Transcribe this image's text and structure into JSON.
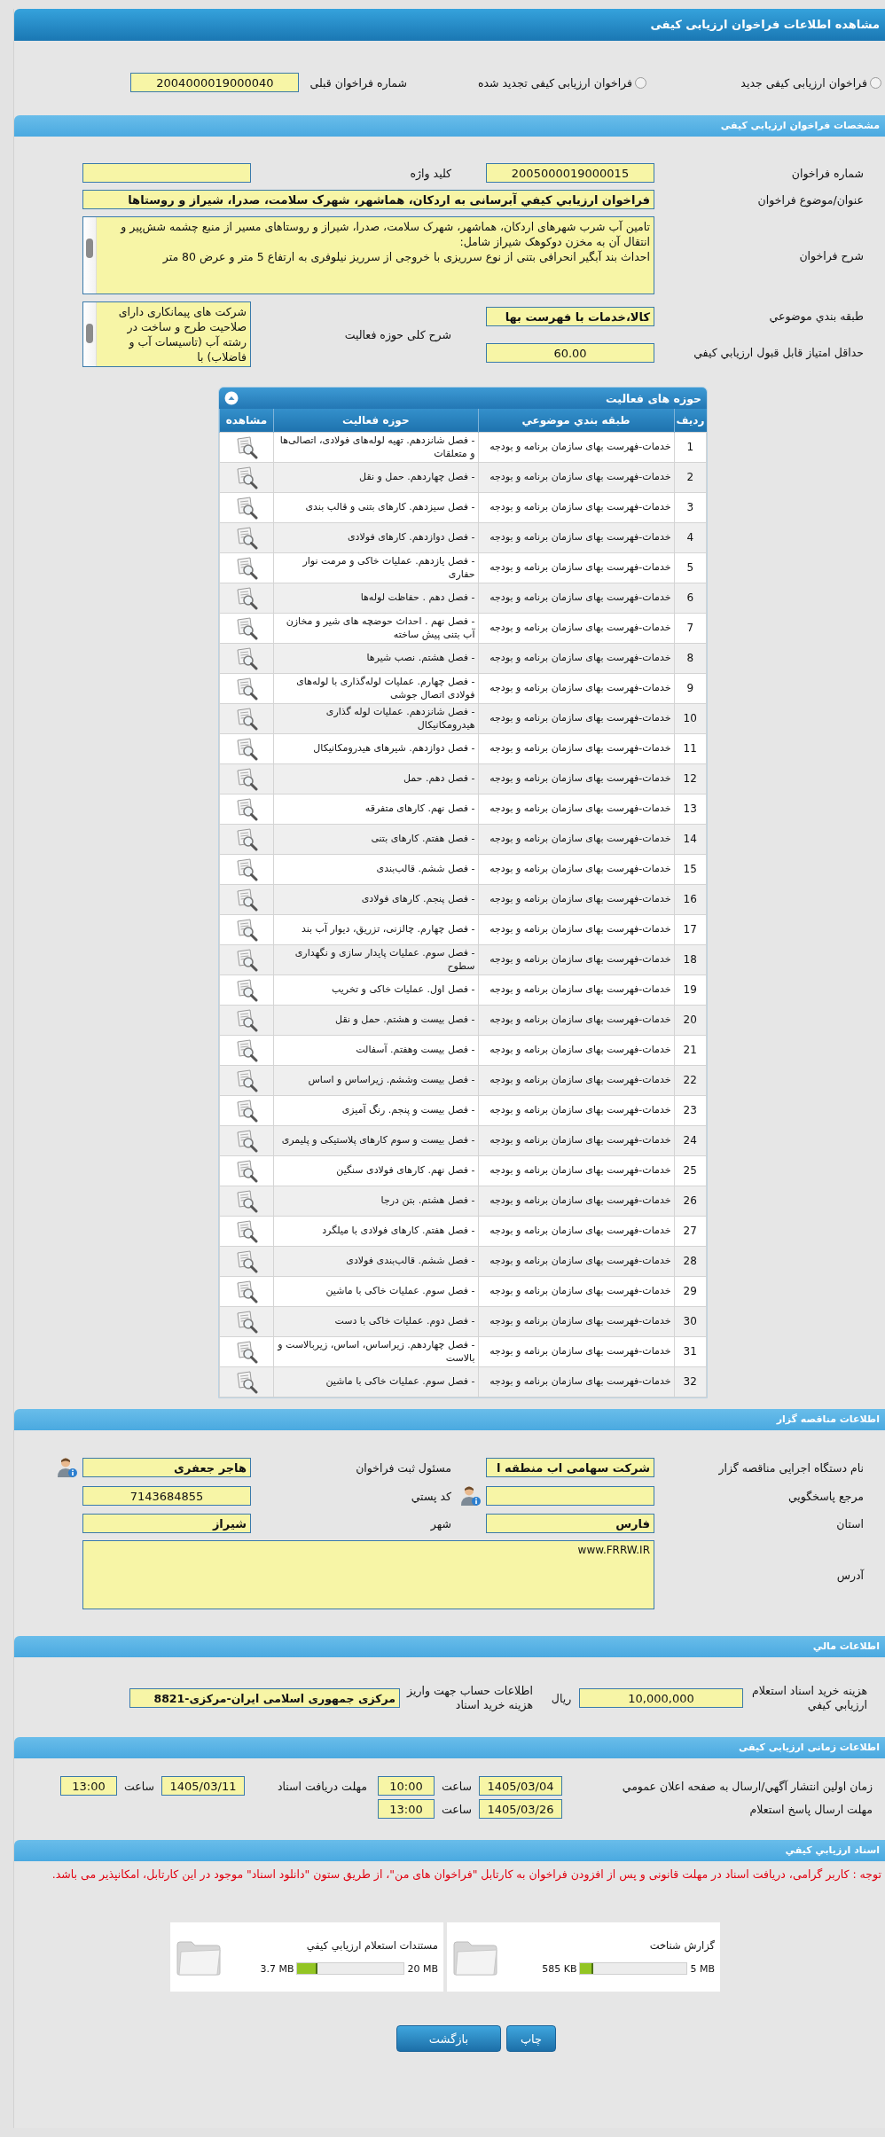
{
  "page_title": "مشاهده اطلاعات فراخوان ارزیابی کیفی",
  "call_types": [
    {
      "label": "فراخوان ارزیابی کیفی جدید",
      "selected": false
    },
    {
      "label": "فراخوان ارزیابی کیفی تجدید شده",
      "selected": false
    }
  ],
  "previous_call": {
    "label": "شماره فراخوان قبلی",
    "value": "2004000019000040"
  },
  "specs": {
    "title": "مشخصات فراخوان ارزیابی کیفی",
    "call_number": {
      "label": "شماره فراخوان",
      "value": "2005000019000015"
    },
    "keyword": {
      "label": "کلید واژه"
    },
    "subject": {
      "label": "عنوان/موضوع فراخوان",
      "value": "فراخوان ارزيابي کيفي آبرسانی به اردکان، هماشهر، شهرک سلامت، صدرا، شیراز و روستاها"
    },
    "description": {
      "label": "شرح فراخوان",
      "value": "تامین آب شرب شهرهای اردکان، هماشهر، شهرک سلامت، صدرا، شیراز و روستاهای مسیر از منبع چشمه شش‌پیر و انتقال آن به مخزن دوکوهک شیراز شامل:\nاحداث بند آبگیر انحرافی بتنی از نوع سرریزی با خروجی از سرریز نیلوفری به ارتفاع 5 متر و عرض 80 متر"
    },
    "category": {
      "label": "طبقه بندي موضوعي",
      "value": "کالا،خدمات با فهرست بها"
    },
    "activity_scope": {
      "label": "شرح کلی حوزه فعالیت",
      "value": "شرکت های پیمانکاری دارای صلاحیت طرح و ساخت در رشته آب (تاسیسات آب و فاضلاب) با"
    },
    "min_score": {
      "label": "حداقل امتياز قابل قبول ارزيابي کيفي",
      "value": "60.00"
    }
  },
  "activities": {
    "title": "حوزه های فعالیت",
    "columns": [
      "ردیف",
      "طبقه بندي موضوعي",
      "حوزه فعالیت",
      "مشاهده"
    ],
    "rows": [
      {
        "index": "1",
        "category": "خدمات-فهرست بهای سازمان برنامه و بودجه",
        "activity": "- فصل شانزدهم. تهیه لوله‌های فولادی، اتصالی‌ها و متعلقات"
      },
      {
        "index": "2",
        "category": "خدمات-فهرست بهای سازمان برنامه و بودجه",
        "activity": "- فصل چهاردهم. حمل و نقل"
      },
      {
        "index": "3",
        "category": "خدمات-فهرست بهای سازمان برنامه و بودجه",
        "activity": "- فصل سیزدهم. کارهای بتنی و قالب بندی"
      },
      {
        "index": "4",
        "category": "خدمات-فهرست بهای سازمان برنامه و بودجه",
        "activity": "- فصل دوازدهم. کارهای فولادی"
      },
      {
        "index": "5",
        "category": "خدمات-فهرست بهای سازمان برنامه و بودجه",
        "activity": "- فصل یازدهم. عملیات خاکی و مرمت نوار حفاری"
      },
      {
        "index": "6",
        "category": "خدمات-فهرست بهای سازمان برنامه و بودجه",
        "activity": "- فصل دهم . حفاظت لوله‌ها"
      },
      {
        "index": "7",
        "category": "خدمات-فهرست بهای سازمان برنامه و بودجه",
        "activity": "- فصل نهم . احداث حوضچه های شیر و مخازن آب بتنی پیش ساخته"
      },
      {
        "index": "8",
        "category": "خدمات-فهرست بهای سازمان برنامه و بودجه",
        "activity": "- فصل هشتم. نصب شیرها"
      },
      {
        "index": "9",
        "category": "خدمات-فهرست بهای سازمان برنامه و بودجه",
        "activity": "- فصل چهارم. عملیات لوله‌گذاری با لوله‌های فولادی اتصال جوشی"
      },
      {
        "index": "10",
        "category": "خدمات-فهرست بهای سازمان برنامه و بودجه",
        "activity": "- فصل شانزدهم. عملیات لوله گذاری هیدرومکانیکال"
      },
      {
        "index": "11",
        "category": "خدمات-فهرست بهای سازمان برنامه و بودجه",
        "activity": "- فصل دوازدهم. شیرهای هیدرومکانیکال"
      },
      {
        "index": "12",
        "category": "خدمات-فهرست بهای سازمان برنامه و بودجه",
        "activity": "- فصل دهم. حمل"
      },
      {
        "index": "13",
        "category": "خدمات-فهرست بهای سازمان برنامه و بودجه",
        "activity": "- فصل نهم. کارهای متفرقه"
      },
      {
        "index": "14",
        "category": "خدمات-فهرست بهای سازمان برنامه و بودجه",
        "activity": "- فصل هفتم. کارهای بتنی"
      },
      {
        "index": "15",
        "category": "خدمات-فهرست بهای سازمان برنامه و بودجه",
        "activity": "- فصل ششم. قالب‌بندی"
      },
      {
        "index": "16",
        "category": "خدمات-فهرست بهای سازمان برنامه و بودجه",
        "activity": "- فصل پنجم. کارهای فولادی"
      },
      {
        "index": "17",
        "category": "خدمات-فهرست بهای سازمان برنامه و بودجه",
        "activity": "- فصل چهارم. چالزنی، تزریق، دیوار آب بند"
      },
      {
        "index": "18",
        "category": "خدمات-فهرست بهای سازمان برنامه و بودجه",
        "activity": "- فصل سوم. عملیات پایدار سازی و نگهداری سطوح"
      },
      {
        "index": "19",
        "category": "خدمات-فهرست بهای سازمان برنامه و بودجه",
        "activity": "- فصل اول. عملیات خاکی و تخریب"
      },
      {
        "index": "20",
        "category": "خدمات-فهرست بهای سازمان برنامه و بودجه",
        "activity": "- فصل بیست و هشتم. حمل و نقل"
      },
      {
        "index": "21",
        "category": "خدمات-فهرست بهای سازمان برنامه و بودجه",
        "activity": "- فصل بیست وهفتم. آسفالت"
      },
      {
        "index": "22",
        "category": "خدمات-فهرست بهای سازمان برنامه و بودجه",
        "activity": "- فصل بیست وششم. زیراساس و اساس"
      },
      {
        "index": "23",
        "category": "خدمات-فهرست بهای سازمان برنامه و بودجه",
        "activity": "- فصل بیست و پنجم. رنگ آمیزی"
      },
      {
        "index": "24",
        "category": "خدمات-فهرست بهای سازمان برنامه و بودجه",
        "activity": "- فصل بیست و سوم کارهای پلاستیکی و پلیمری"
      },
      {
        "index": "25",
        "category": "خدمات-فهرست بهای سازمان برنامه و بودجه",
        "activity": "- فصل نهم. کارهای فولادی سنگین"
      },
      {
        "index": "26",
        "category": "خدمات-فهرست بهای سازمان برنامه و بودجه",
        "activity": "- فصل هشتم. بتن درجا"
      },
      {
        "index": "27",
        "category": "خدمات-فهرست بهای سازمان برنامه و بودجه",
        "activity": "- فصل هفتم. کارهای فولادی با میلگرد"
      },
      {
        "index": "28",
        "category": "خدمات-فهرست بهای سازمان برنامه و بودجه",
        "activity": "- فصل ششم. قالب‌بندی فولادی"
      },
      {
        "index": "29",
        "category": "خدمات-فهرست بهای سازمان برنامه و بودجه",
        "activity": "- فصل سوم. عملیات خاکی با ماشین"
      },
      {
        "index": "30",
        "category": "خدمات-فهرست بهای سازمان برنامه و بودجه",
        "activity": "- فصل دوم. عملیات خاکی با دست"
      },
      {
        "index": "31",
        "category": "خدمات-فهرست بهای سازمان برنامه و بودجه",
        "activity": "- فصل چهاردهم. زیراساس، اساس، زیربالاست و بالاست"
      },
      {
        "index": "32",
        "category": "خدمات-فهرست بهای سازمان برنامه و بودجه",
        "activity": "- فصل سوم. عملیات خاکی با ماشین"
      }
    ]
  },
  "organizer": {
    "title": "اطلاعات مناقصه گزار",
    "org_name": {
      "label": "نام دستگاه اجرایی مناقصه گزار",
      "value": "شرکت سهامی اب منطقه ا"
    },
    "registrar": {
      "label": "مسئول ثبت فراخوان",
      "value": "هاجر جعفری"
    },
    "reference": {
      "label": "مرجع پاسخگويي"
    },
    "postal_code": {
      "label": "کد پستي",
      "value": "7143684855"
    },
    "province": {
      "label": "استان",
      "value": "فارس"
    },
    "city": {
      "label": "شهر",
      "value": "شیراز"
    },
    "address": {
      "label": "آدرس",
      "value": "www.FRRW.IR"
    }
  },
  "finance": {
    "title": "اطلاعات مالي",
    "fee": {
      "label": "هزینه خرید اسناد استعلام ارزيابي کيفي",
      "value": "10,000,000",
      "unit": "ریال"
    },
    "account": {
      "label": "اطلاعات حساب جهت واریز هزینه خرید اسناد",
      "value": "مرکزی جمهوری اسلامی ایران-مرکزی-8821"
    }
  },
  "schedule": {
    "title": "اطلاعات زمانی ارزیابی کیفی",
    "items": [
      {
        "label": "زمان اولین انتشار آگهي/ارسال به صفحه اعلان عمومي",
        "date": "1405/03/04",
        "time_label": "ساعت",
        "time": "10:00"
      },
      {
        "label": "مهلت دریافت اسناد",
        "date": "1405/03/11",
        "time_label": "ساعت",
        "time": "13:00"
      },
      {
        "label": "مهلت ارسال پاسخ استعلام",
        "date": "1405/03/26",
        "time_label": "ساعت",
        "time": "13:00"
      }
    ]
  },
  "documents": {
    "title": "اسناد ارزيابي کيفي",
    "notice": "توجه : کاربر گرامی، دریافت اسناد در مهلت قانونی و پس از افزودن فراخوان به کارتابل \"فراخوان های من\"، از طریق ستون \"دانلود اسناد\" موجود در این کارتابل، امکانپذیر می باشد.",
    "files": [
      {
        "name": "گزارش شناخت",
        "size": "585 KB",
        "max": "5 MB",
        "level": 0.12
      },
      {
        "name": "مستندات استعلام ارزيابي کيفي",
        "size": "3.7 MB",
        "max": "20 MB",
        "level": 0.19
      }
    ]
  },
  "buttons": [
    "چاپ",
    "بازگشت"
  ]
}
